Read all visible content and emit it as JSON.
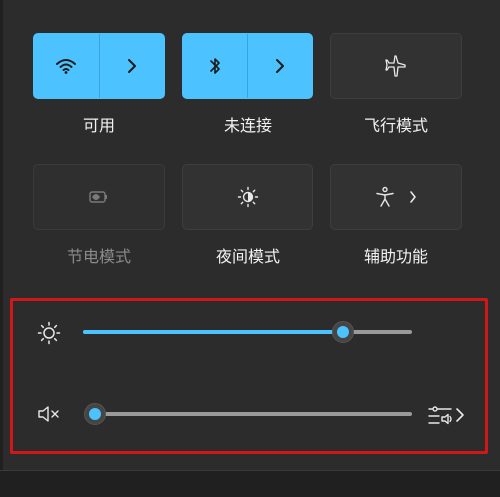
{
  "tiles": [
    {
      "label": "可用",
      "icon": "wifi-icon",
      "state": "on"
    },
    {
      "label": "未连接",
      "icon": "bluetooth-icon",
      "state": "on"
    },
    {
      "label": "飞行模式",
      "icon": "airplane-icon",
      "state": "off"
    },
    {
      "label": "节电模式",
      "icon": "battery-saver-icon",
      "state": "disabled"
    },
    {
      "label": "夜间模式",
      "icon": "night-light-icon",
      "state": "off"
    },
    {
      "label": "辅助功能",
      "icon": "accessibility-icon",
      "state": "off"
    }
  ],
  "sliders": {
    "brightness": {
      "icon": "brightness-icon",
      "value_fraction": 0.79
    },
    "volume": {
      "icon": "speaker-muted-icon",
      "value_fraction": 0.0
    }
  },
  "colors": {
    "accent": "#4cc2ff",
    "panel": "#2c2c2c",
    "highlight_box": "#d01818"
  }
}
